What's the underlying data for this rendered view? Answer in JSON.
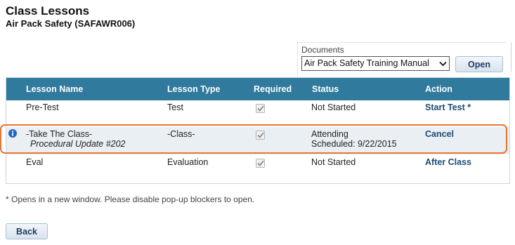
{
  "page": {
    "title": "Class Lessons",
    "subtitle": "Air Pack Safety (SAFAWR006)"
  },
  "documents": {
    "label": "Documents",
    "selected": "Air Pack Safety Training Manual",
    "open_label": "Open"
  },
  "table": {
    "headers": {
      "lesson_name": "Lesson Name",
      "lesson_type": "Lesson Type",
      "required": "Required",
      "status": "Status",
      "action": "Action"
    },
    "rows": [
      {
        "name": "Pre-Test",
        "sub": "",
        "type": "Test",
        "required": true,
        "status": "Not Started",
        "status_detail": "",
        "action": "Start Test *"
      },
      {
        "name": "-Take The Class-",
        "sub": "Procedural Update #202",
        "type": "-Class-",
        "required": true,
        "status": "Attending",
        "status_detail": "Scheduled: 9/22/2015",
        "action": "Cancel"
      },
      {
        "name": "Eval",
        "sub": "",
        "type": "Evaluation",
        "required": true,
        "status": "Not Started",
        "status_detail": "",
        "action": "After Class"
      }
    ]
  },
  "footnote": "* Opens in a new window. Please disable pop-up blockers to open.",
  "back_label": "Back",
  "colors": {
    "header_bg": "#2f7a9d",
    "highlight_border": "#e8762e",
    "action_link": "#1b4b73",
    "info_icon": "#2266c2"
  },
  "icons": [
    "chevron-down-icon",
    "info-icon",
    "checkmark-icon"
  ]
}
